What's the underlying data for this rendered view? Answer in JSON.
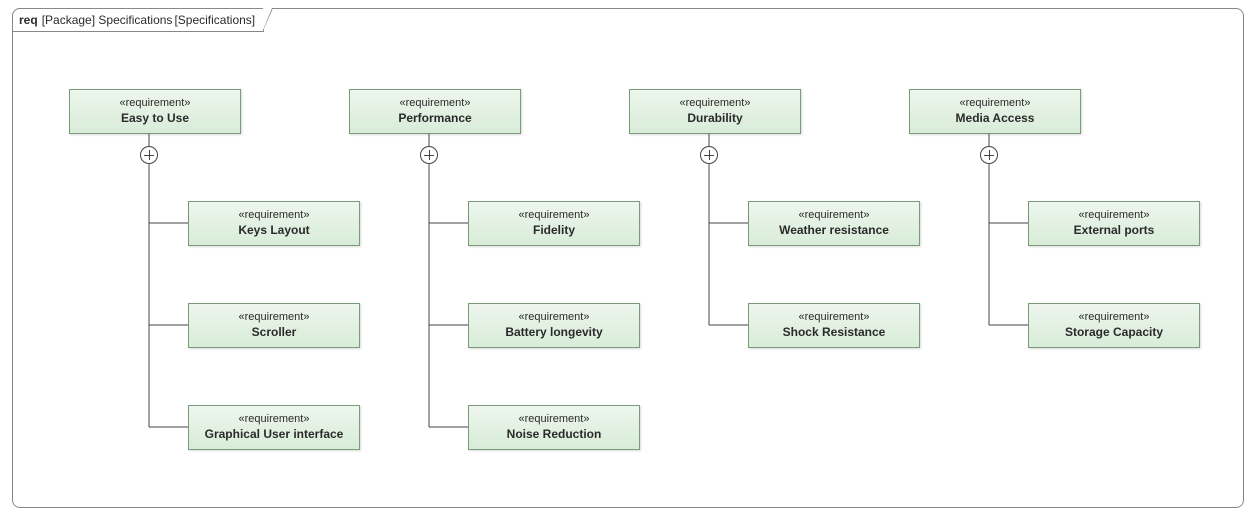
{
  "frame": {
    "kind": "req",
    "scope": "[Package] Specifications",
    "view": "[Specifications]"
  },
  "stereotype": "«requirement»",
  "columns": [
    {
      "parent": "Easy to Use",
      "children": [
        "Keys Layout",
        "Scroller",
        "Graphical User interface"
      ]
    },
    {
      "parent": "Performance",
      "children": [
        "Fidelity",
        "Battery longevity",
        "Noise Reduction"
      ]
    },
    {
      "parent": "Durability",
      "children": [
        "Weather resistance",
        "Shock Resistance"
      ]
    },
    {
      "parent": "Media Access",
      "children": [
        "External ports",
        "Storage Capacity"
      ]
    }
  ]
}
